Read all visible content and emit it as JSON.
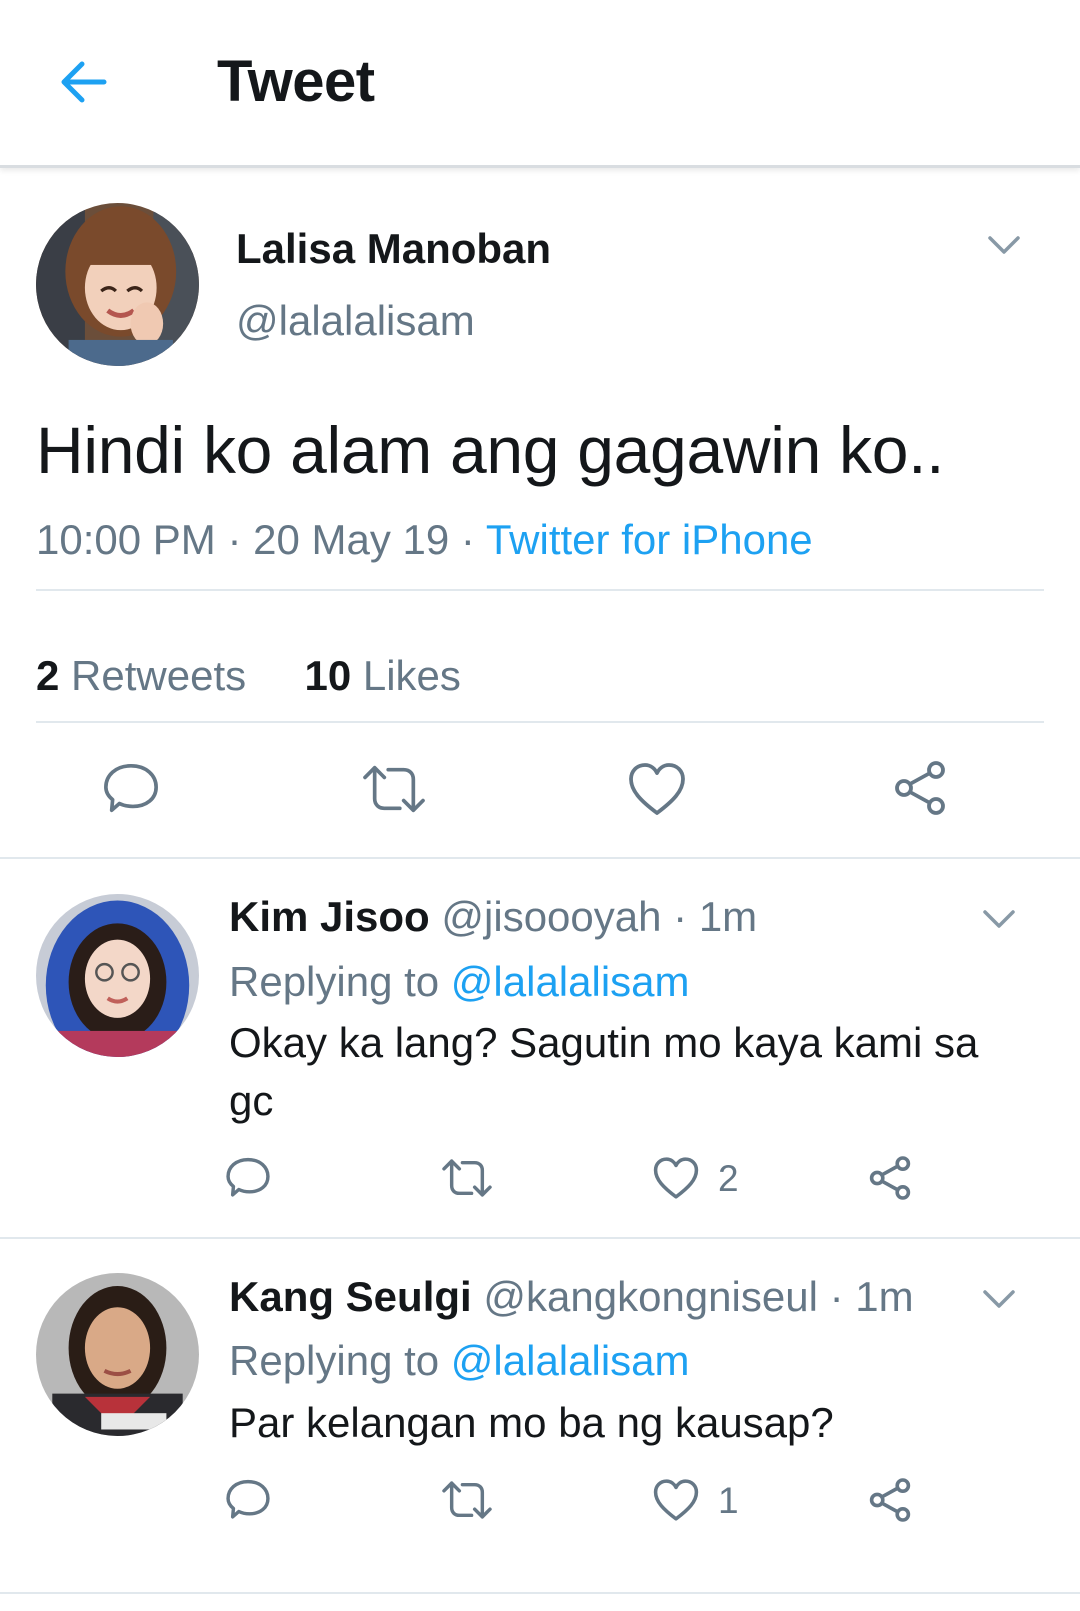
{
  "colors": {
    "accent": "#1da1f2",
    "secondary_text": "#657786",
    "primary_text": "#14171a",
    "divider": "#e1e8ed"
  },
  "header": {
    "title": "Tweet",
    "back_icon": "arrow-left-icon"
  },
  "tweet": {
    "author_name": "Lalisa Manoban",
    "author_handle": "@lalalalisam",
    "text": "Hindi ko alam ang gagawin ko..",
    "time": "10:00 PM",
    "date": "20 May 19",
    "source": "Twitter for iPhone",
    "sep": "·",
    "retweets_count": "2",
    "retweets_label": "Retweets",
    "likes_count": "10",
    "likes_label": "Likes",
    "actions": [
      "reply-icon",
      "retweet-icon",
      "like-icon",
      "share-icon"
    ]
  },
  "replies": [
    {
      "name": "Kim Jisoo",
      "handle": "@jisoooyah",
      "time": "1m",
      "replying_label": "Replying to",
      "replying_to": "@lalalalisam",
      "text": "Okay ka lang? Sagutin mo kaya kami sa gc",
      "likes": "2"
    },
    {
      "name": "Kang Seulgi",
      "handle": "@kangkongniseul",
      "time": "1m",
      "replying_label": "Replying to",
      "replying_to": "@lalalalisam",
      "text": "Par kelangan mo ba ng kausap?",
      "likes": "1"
    }
  ]
}
